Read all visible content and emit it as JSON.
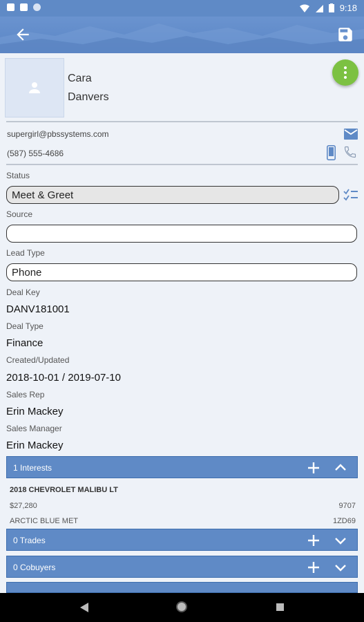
{
  "status_bar": {
    "time": "9:18",
    "left_icons": [
      "sim-icon",
      "sd-card-icon",
      "sync-icon"
    ],
    "right_icons": [
      "wifi-icon",
      "no-sim-icon",
      "battery-icon"
    ]
  },
  "app_bar": {
    "back_icon": "arrow-back-icon",
    "save_icon": "save-icon",
    "color": "#5f8ac6"
  },
  "contact": {
    "first_name": "Cara",
    "last_name": "Danvers",
    "email": "supergirl@pbssystems.com",
    "phone": "(587) 555-4686"
  },
  "fields": {
    "status_label": "Status",
    "status_value": "Meet & Greet",
    "source_label": "Source",
    "source_value": "",
    "lead_type_label": "Lead Type",
    "lead_type_value": "Phone",
    "deal_key_label": "Deal Key",
    "deal_key_value": "DANV181001",
    "deal_type_label": "Deal Type",
    "deal_type_value": "Finance",
    "created_label": "Created/Updated",
    "created_value": "2018-10-01 / 2019-07-10",
    "sales_rep_label": "Sales Rep",
    "sales_rep_value": "Erin Mackey",
    "sales_manager_label": "Sales Manager",
    "sales_manager_value": "Erin Mackey"
  },
  "sections": {
    "interests": "1  Interests",
    "trades": "0  Trades",
    "cobuyers": "0  Cobuyers"
  },
  "vehicle": {
    "title": "2018 CHEVROLET MALIBU LT",
    "price": "$27,280",
    "stock": "9707",
    "color": "ARCTIC BLUE MET",
    "vin": "1ZD69"
  },
  "colors": {
    "accent": "#5f8ac6",
    "fab": "#7cc142"
  }
}
